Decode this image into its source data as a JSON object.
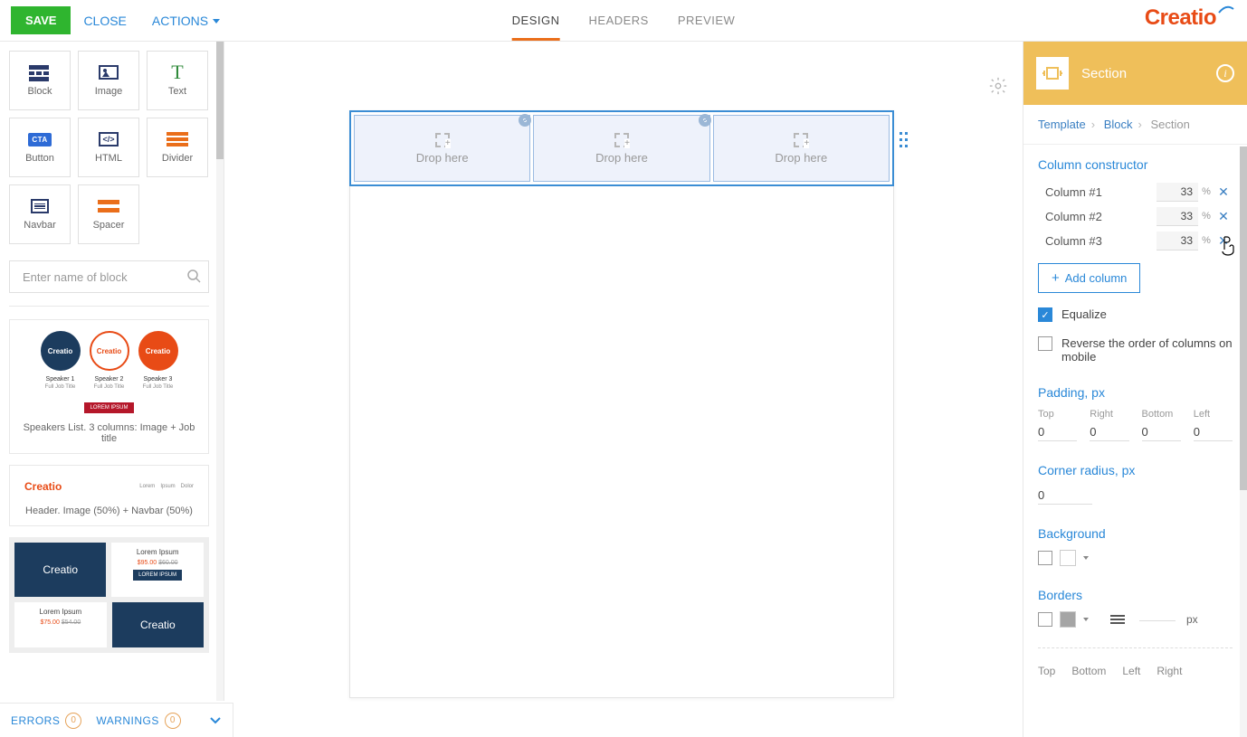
{
  "topbar": {
    "save": "SAVE",
    "close": "CLOSE",
    "actions": "ACTIONS",
    "tabs": {
      "design": "DESIGN",
      "headers": "HEADERS",
      "preview": "PREVIEW"
    },
    "logo": "Creatio"
  },
  "tools": {
    "block": "Block",
    "image": "Image",
    "text": "Text",
    "button": "Button",
    "html": "HTML",
    "divider": "Divider",
    "navbar": "Navbar",
    "spacer": "Spacer",
    "cta_text": "CTA",
    "html_text": "</>"
  },
  "search": {
    "placeholder": "Enter name of block"
  },
  "blocks": {
    "speakers": {
      "caption": "Speakers List. 3 columns: Image + Job title",
      "brand": "Creatio",
      "sp1": "Speaker 1",
      "sp2": "Speaker 2",
      "sp3": "Speaker 3",
      "sub": "Full Job Title",
      "badge": "LOREM IPSUM"
    },
    "header": {
      "caption": "Header. Image (50%) + Navbar (50%)",
      "brand": "Creatio",
      "l1": "Lorem",
      "l2": "Ipsum",
      "l3": "Dolor"
    },
    "products": {
      "brand": "Creatio",
      "li": "Lorem Ipsum",
      "price_new": "$95.00",
      "price_old": "$60.00",
      "btn": "LOREM IPSUM",
      "price2_new": "$75.00",
      "price2_old": "$54.00"
    }
  },
  "canvas": {
    "drop1": "Drop here",
    "drop2": "Drop here",
    "drop3": "Drop here"
  },
  "right": {
    "title": "Section",
    "info": "i",
    "crumb": {
      "a": "Template",
      "b": "Block",
      "c": "Section"
    },
    "column_constructor": "Column constructor",
    "columns": [
      {
        "name": "Column #1",
        "val": "33",
        "unit": "%"
      },
      {
        "name": "Column #2",
        "val": "33",
        "unit": "%"
      },
      {
        "name": "Column #3",
        "val": "33",
        "unit": "%"
      }
    ],
    "add_column": "Add column",
    "equalize": "Equalize",
    "reverse": "Reverse the order of columns on mobile",
    "padding_title": "Padding, px",
    "padding": {
      "top_l": "Top",
      "right_l": "Right",
      "bottom_l": "Bottom",
      "left_l": "Left",
      "top": "0",
      "right": "0",
      "bottom": "0",
      "left": "0"
    },
    "corner_title": "Corner radius, px",
    "corner_val": "0",
    "bg_title": "Background",
    "borders_title": "Borders",
    "border_unit": "px",
    "border_sides": {
      "top": "Top",
      "bottom": "Bottom",
      "left": "Left",
      "right": "Right"
    }
  },
  "bottom": {
    "errors": "ERRORS",
    "errors_n": "0",
    "warnings": "WARNINGS",
    "warnings_n": "0"
  }
}
